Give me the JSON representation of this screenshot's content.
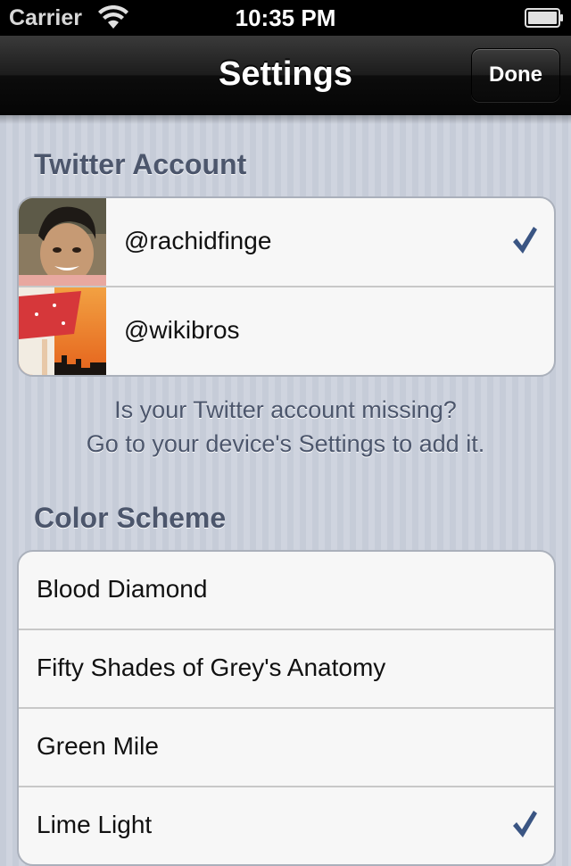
{
  "status_bar": {
    "carrier": "Carrier",
    "time": "10:35 PM",
    "wifi_icon": "wifi-icon",
    "battery_icon": "battery-icon"
  },
  "nav": {
    "title": "Settings",
    "done_label": "Done"
  },
  "twitter_section": {
    "header": "Twitter Account",
    "accounts": [
      {
        "handle": "@rachidfinge",
        "selected": true,
        "avatar": "avatar-man-icon"
      },
      {
        "handle": "@wikibros",
        "selected": false,
        "avatar": "avatar-sunset-icon"
      }
    ],
    "note_line1": "Is your Twitter account missing?",
    "note_line2": "Go to your device's Settings to add it."
  },
  "color_section": {
    "header": "Color Scheme",
    "schemes": [
      {
        "label": "Blood Diamond",
        "selected": false
      },
      {
        "label": "Fifty Shades of Grey's Anatomy",
        "selected": false
      },
      {
        "label": "Green Mile",
        "selected": false
      },
      {
        "label": "Lime Light",
        "selected": true
      }
    ]
  },
  "colors": {
    "checkmark": "#3a5583",
    "section_header": "#4c566c",
    "nav_bar": "#111111"
  }
}
